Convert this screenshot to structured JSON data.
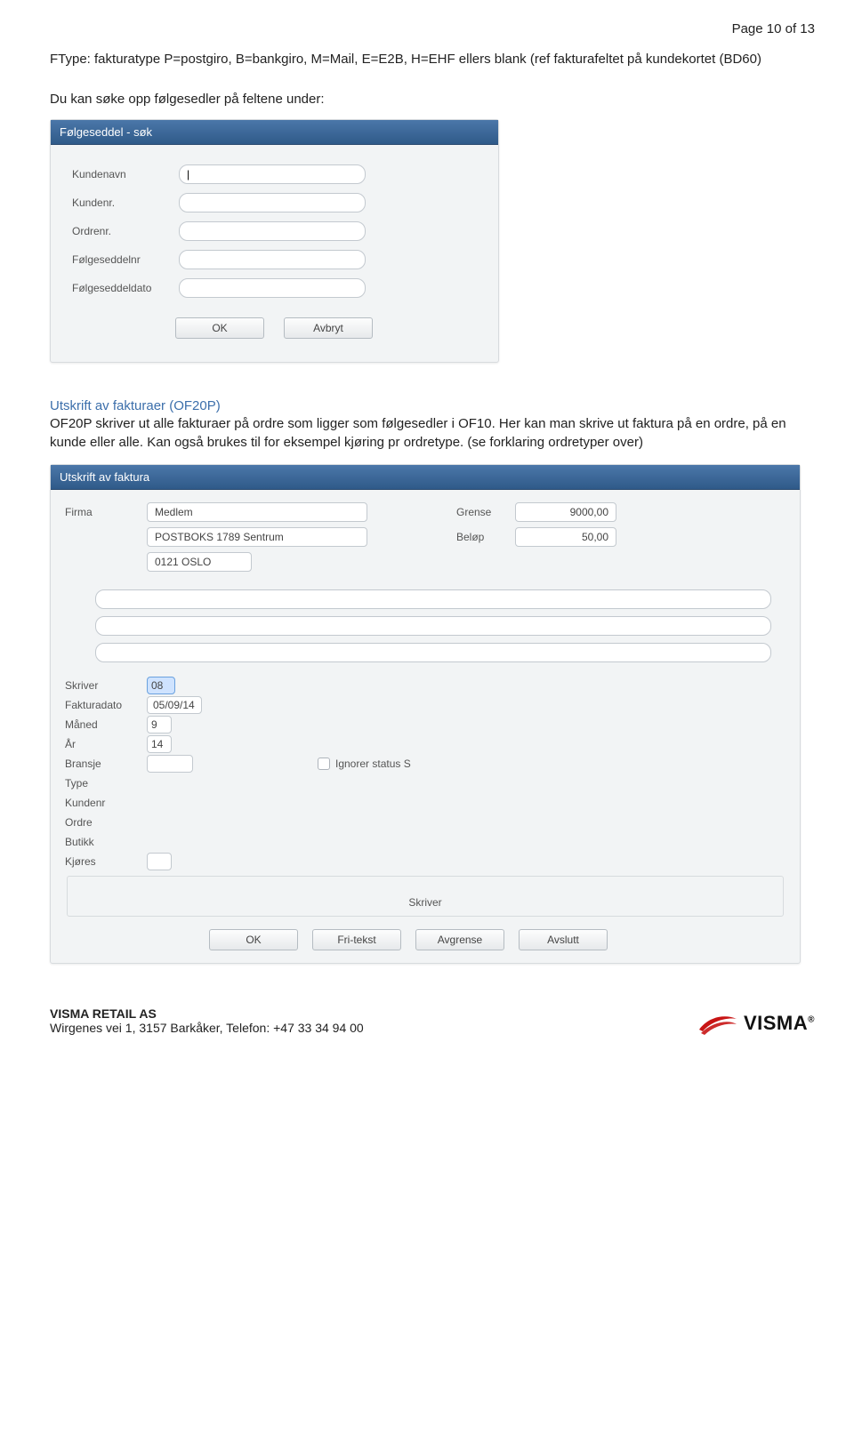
{
  "page_number": "Page 10 of 13",
  "intro": "FType: fakturatype P=postgiro, B=bankgiro, M=Mail, E=E2B, H=EHF ellers blank (ref fakturafeltet på kundekortet (BD60)",
  "sub_intro": "Du kan søke opp følgesedler på feltene under:",
  "panel1": {
    "title": "Følgeseddel - søk",
    "labels": {
      "kundenavn": "Kundenavn",
      "kundenr": "Kundenr.",
      "ordrenr": "Ordrenr.",
      "folgeseddelnr": "Følgeseddelnr",
      "folgeseddeldato": "Følgeseddeldato"
    },
    "values": {
      "kundenavn": "|",
      "kundenr": "",
      "ordrenr": "",
      "folgeseddelnr": "",
      "folgeseddeldato": ""
    },
    "ok": "OK",
    "avbryt": "Avbryt"
  },
  "section2": {
    "title": "Utskrift av fakturaer (OF20P)",
    "text": "OF20P skriver ut alle fakturaer på ordre som ligger som følgesedler i OF10. Her kan man skrive ut faktura på en ordre, på en kunde eller alle. Kan også brukes til for eksempel kjøring pr ordretype. (se forklaring ordretyper over)"
  },
  "panel2": {
    "title": "Utskrift av faktura",
    "labels": {
      "firma": "Firma",
      "grense": "Grense",
      "belop": "Beløp",
      "skriver": "Skriver",
      "fakturadato": "Fakturadato",
      "maned": "Måned",
      "ar": "År",
      "bransje": "Bransje",
      "type": "Type",
      "kundenr": "Kundenr",
      "ordre": "Ordre",
      "butikk": "Butikk",
      "kjores": "Kjøres",
      "ignorer": "Ignorer status S"
    },
    "values": {
      "firma1": "Medlem",
      "firma2": "POSTBOKS 1789 Sentrum",
      "firma3": "0121 OSLO",
      "grense": "9000,00",
      "belop": "50,00",
      "skriver": "08",
      "fakturadato": "05/09/14",
      "maned": "9",
      "ar": "14",
      "bransje": "",
      "type": "",
      "kundenr": "",
      "ordre": "",
      "butikk": "",
      "kjores": ""
    },
    "inner_label": "Skriver",
    "buttons": {
      "ok": "OK",
      "fritekst": "Fri-tekst",
      "avgrense": "Avgrense",
      "avslutt": "Avslutt"
    }
  },
  "footer": {
    "company": "VISMA RETAIL AS",
    "address": "Wirgenes vei 1, 3157 Barkåker, Telefon: +47 33 34 94 00",
    "logo_text": "VISMA"
  }
}
